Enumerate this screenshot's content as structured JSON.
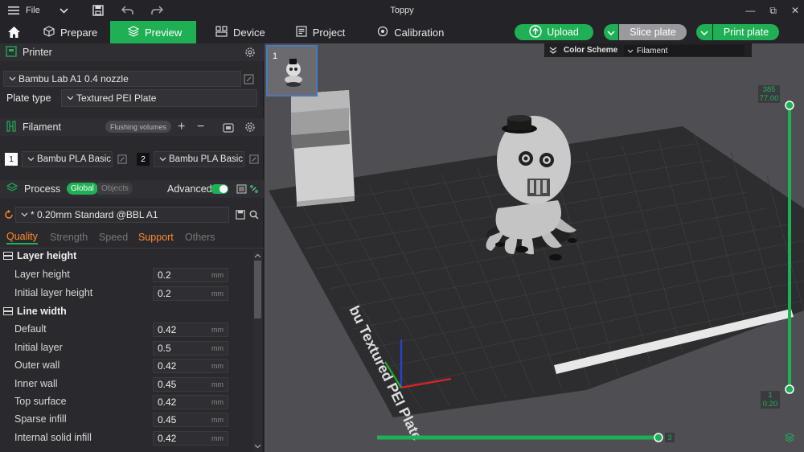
{
  "titlebar": {
    "file_label": "File",
    "app_title": "Toppy",
    "minimize": "—",
    "maximize": "⧉",
    "close": "✕"
  },
  "toolbar": {
    "tabs": [
      {
        "label": "Prepare"
      },
      {
        "label": "Preview"
      },
      {
        "label": "Device"
      },
      {
        "label": "Project"
      },
      {
        "label": "Calibration"
      }
    ],
    "upload_label": "Upload",
    "slice_label": "Slice plate",
    "print_label": "Print plate"
  },
  "printer": {
    "section_title": "Printer",
    "printer_name": "Bambu Lab A1 0.4 nozzle",
    "plate_type_label": "Plate type",
    "plate_type_value": "Textured PEI Plate"
  },
  "filament": {
    "section_title": "Filament",
    "flushing_label": "Flushing volumes",
    "slots": [
      {
        "number": "1",
        "name": "Bambu PLA Basic",
        "color": "#ffffff"
      },
      {
        "number": "2",
        "name": "Bambu PLA Basic",
        "color": "#111111"
      }
    ]
  },
  "process": {
    "section_title": "Process",
    "global_label": "Global",
    "objects_label": "Objects",
    "advanced_label": "Advanced",
    "preset": "* 0.20mm Standard @BBL A1",
    "subtabs": [
      "Quality",
      "Strength",
      "Speed",
      "Support",
      "Others"
    ]
  },
  "params": {
    "layer_height_group": "Layer height",
    "line_width_group": "Line width",
    "unit": "mm",
    "layer": [
      {
        "label": "Layer height",
        "value": "0.2"
      },
      {
        "label": "Initial layer height",
        "value": "0.2"
      }
    ],
    "width": [
      {
        "label": "Default",
        "value": "0.42"
      },
      {
        "label": "Initial layer",
        "value": "0.5"
      },
      {
        "label": "Outer wall",
        "value": "0.42"
      },
      {
        "label": "Inner wall",
        "value": "0.45"
      },
      {
        "label": "Top surface",
        "value": "0.42"
      },
      {
        "label": "Sparse infill",
        "value": "0.45"
      },
      {
        "label": "Internal solid infill",
        "value": "0.42"
      }
    ]
  },
  "viewport": {
    "plate_thumb_number": "1",
    "color_scheme_label": "Color Scheme",
    "color_scheme_value": "Filament",
    "plate_text": "bu Textured PEI Plate",
    "layer_top_number": "385",
    "layer_top_height": "77.00",
    "layer_bottom_number": "1",
    "layer_bottom_height": "0.20",
    "move_slider_value": "3"
  },
  "colors": {
    "accent": "#1faf55",
    "panel": "#2a2a2e",
    "viewport": "#4f4f53",
    "support": "#ff8a2a"
  }
}
